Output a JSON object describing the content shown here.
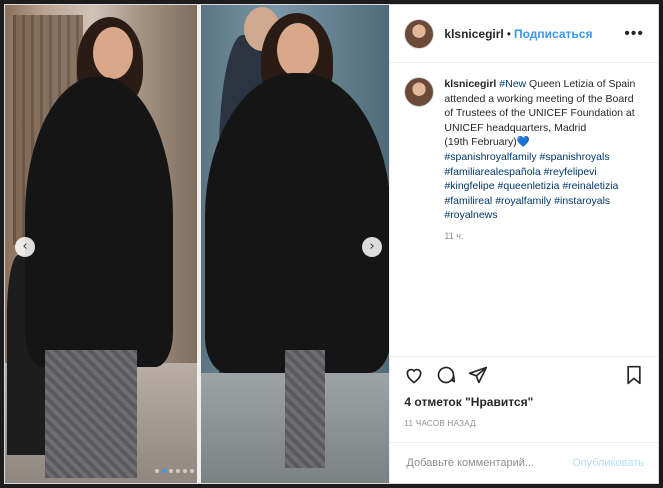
{
  "header": {
    "username": "klsnicegirl",
    "separator": "•",
    "follow_label": "Подписаться",
    "more_glyph": "•••"
  },
  "caption": {
    "username": "klsnicegirl",
    "hashtag_new": "#New",
    "text": " Queen Letizia of Spain attended a working meeting of the Board of Trustees of the UNICEF Foundation at UNICEF headquarters, Madrid",
    "date_line": "(19th February)",
    "heart": "💙",
    "hashtags": [
      "#spanishroyalfamily",
      "#spanishroyals",
      "#familiarealespañola",
      "#reyfelipevi",
      "#kingfelipe",
      "#queenletizia",
      "#reinaletizia",
      "#familireal",
      "#royalfamily",
      "#instaroyals",
      "#royalnews"
    ],
    "time": "11 ч."
  },
  "media": {
    "prev_glyph": "‹",
    "next_glyph": "›",
    "dots_count": 6,
    "active_dot": 1
  },
  "actions": {
    "icons": [
      "heart-icon",
      "comment-icon",
      "share-icon",
      "bookmark-icon"
    ]
  },
  "likes": "4 отметок \"Нравится\"",
  "posted_ago": "11 ЧАСОВ НАЗАД",
  "comment": {
    "placeholder": "Добавьте комментарий...",
    "publish_label": "Опубликовать"
  },
  "colors": {
    "link": "#3897f0",
    "hashtag": "#00376b",
    "publish_disabled": "#b2dffc"
  }
}
